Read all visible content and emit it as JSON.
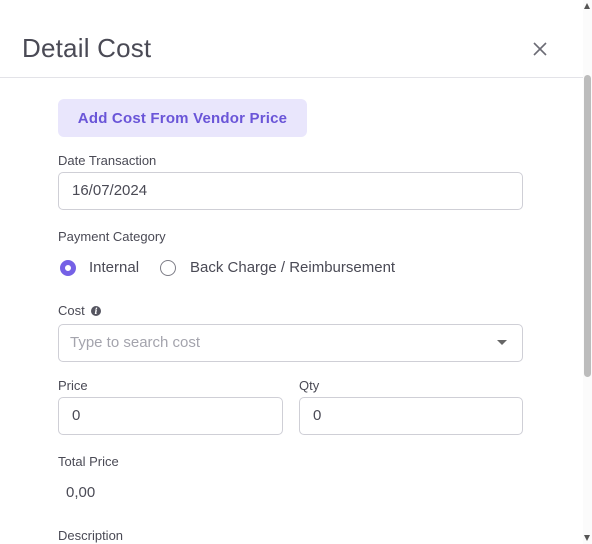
{
  "modal": {
    "title": "Detail Cost"
  },
  "vendor_button_label": "Add Cost From Vendor Price",
  "date_transaction": {
    "label": "Date Transaction",
    "value": "16/07/2024"
  },
  "payment_category": {
    "label": "Payment Category",
    "options": [
      {
        "label": "Internal",
        "selected": true
      },
      {
        "label": "Back Charge / Reimbursement",
        "selected": false
      }
    ]
  },
  "cost": {
    "label": "Cost",
    "placeholder": "Type to search cost"
  },
  "price": {
    "label": "Price",
    "value": "0"
  },
  "qty": {
    "label": "Qty",
    "value": "0"
  },
  "total_price": {
    "label": "Total Price",
    "value": "0,00"
  },
  "description": {
    "label": "Description"
  },
  "colors": {
    "accent": "#7561e6",
    "accent_light": "#e9e6fc",
    "border": "#cfcfd6"
  },
  "icons": {
    "close": "close-icon",
    "info": "info-icon",
    "dropdown": "chevron-down-icon"
  }
}
